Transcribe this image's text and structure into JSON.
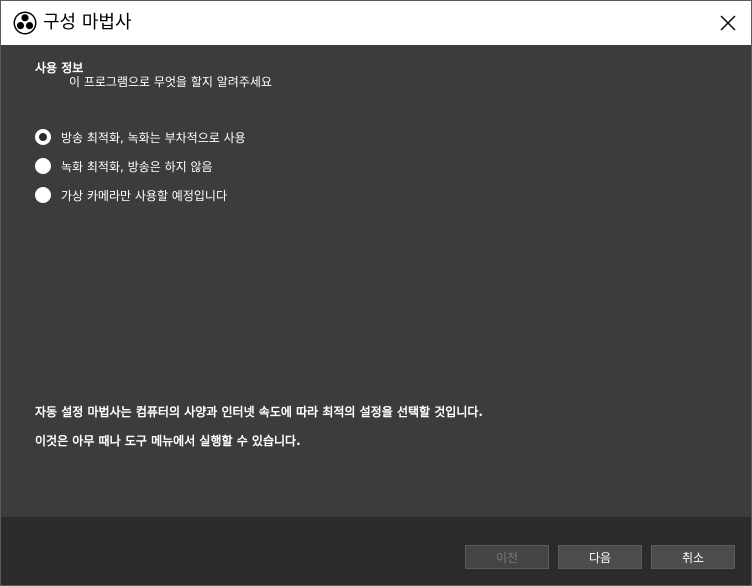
{
  "window": {
    "title": "구성 마법사"
  },
  "usage": {
    "heading": "사용 정보",
    "subtitle": "이 프로그램으로 무엇을 할지 알려주세요",
    "options": [
      {
        "label": "방송 최적화, 녹화는 부차적으로 사용",
        "checked": true
      },
      {
        "label": "녹화 최적화, 방송은 하지 않음",
        "checked": false
      },
      {
        "label": "가상 카메라만 사용할 예정입니다",
        "checked": false
      }
    ]
  },
  "info": {
    "line1": "자동 설정 마법사는 컴퓨터의 사양과 인터넷 속도에 따라 최적의 설정을 선택할 것입니다.",
    "line2": "이것은 아무 때나 도구 메뉴에서 실행할 수 있습니다."
  },
  "buttons": {
    "back": "이전",
    "next": "다음",
    "cancel": "취소"
  },
  "colors": {
    "content_bg": "#3c3c3c",
    "footer_bg": "#2b2b2b",
    "titlebar_bg": "#ffffff"
  }
}
